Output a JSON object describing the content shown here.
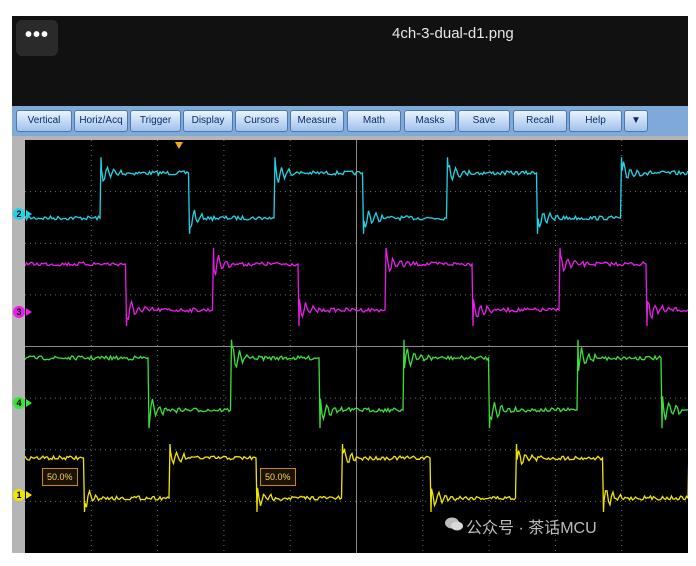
{
  "window": {
    "title": "4ch-3-dual-d1.png",
    "menu_icon": "more-dots-icon",
    "menu_glyph": "•••"
  },
  "toolbar": {
    "buttons": [
      "Vertical",
      "Horiz/Acq",
      "Trigger",
      "Display",
      "Cursors",
      "Measure",
      "Math",
      "Masks",
      "Save",
      "Recall",
      "Help"
    ],
    "dropdown_glyph": "▼"
  },
  "channels": [
    {
      "label": "2",
      "color": "#22d3e6"
    },
    {
      "label": "3",
      "color": "#e81ee8"
    },
    {
      "label": "4",
      "color": "#3be13b"
    },
    {
      "label": "1",
      "color": "#f0e600"
    }
  ],
  "trigger_labels": [
    "50.0%",
    "50.0%"
  ],
  "watermark": {
    "text": "公众号 · 茶话MCU",
    "icon": "wechat-icon"
  },
  "colors": {
    "toolbar": "#7fa9d9",
    "screen": "#000000",
    "grid": "#6e6e6e"
  }
}
